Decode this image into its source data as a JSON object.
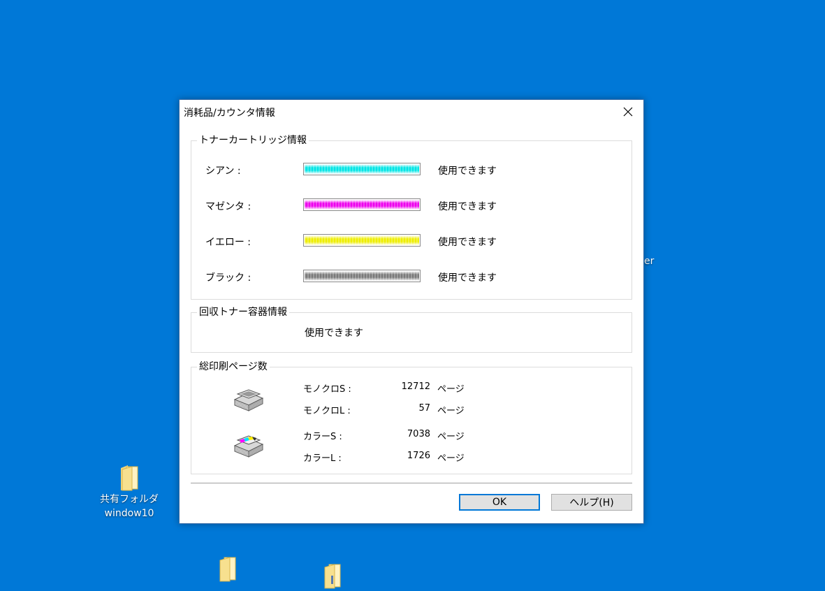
{
  "desktop": {
    "background": "#0078d7",
    "icons": [
      {
        "label_line1": "共有フォルダ",
        "label_line2": "window10"
      },
      {
        "label_line1": "",
        "label_line2": ""
      },
      {
        "label_line1": "",
        "label_line2": ""
      }
    ],
    "edge_text": "er"
  },
  "dialog": {
    "title": "消耗品/カウンタ情報",
    "close_icon": "close-icon",
    "toner_group": {
      "legend": "トナーカートリッジ情報",
      "items": [
        {
          "label": "シアン :",
          "status": "使用できます",
          "color": "#00e5e5",
          "level": 1.0
        },
        {
          "label": "マゼンタ :",
          "status": "使用できます",
          "color": "#ee00ee",
          "level": 1.0
        },
        {
          "label": "イエロー :",
          "status": "使用できます",
          "color": "#eeee00",
          "level": 1.0
        },
        {
          "label": "ブラック :",
          "status": "使用できます",
          "color": "#7a7a7a",
          "level": 1.0
        }
      ]
    },
    "waste_group": {
      "legend": "回収トナー容器情報",
      "status": "使用できます"
    },
    "count_group": {
      "legend": "総印刷ページ数",
      "mono_icon": "mono-paper-stack-icon",
      "color_icon": "color-paper-stack-icon",
      "rows": [
        {
          "label": "モノクロS :",
          "value": "12712",
          "unit": "ページ"
        },
        {
          "label": "モノクロL :",
          "value": "57",
          "unit": "ページ"
        },
        {
          "label": "カラーS :",
          "value": "7038",
          "unit": "ページ"
        },
        {
          "label": "カラーL :",
          "value": "1726",
          "unit": "ページ"
        }
      ]
    },
    "buttons": {
      "ok": "OK",
      "help": "ヘルプ(H)"
    }
  }
}
